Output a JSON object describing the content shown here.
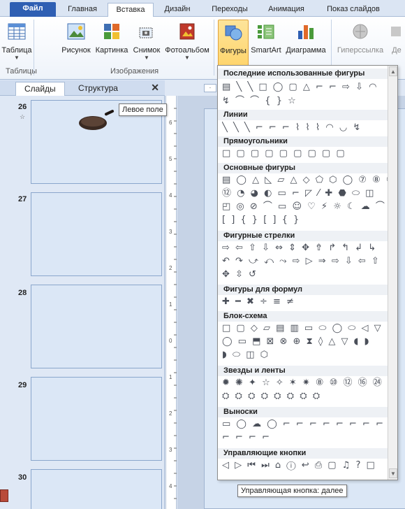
{
  "ribbon_tabs": [
    {
      "label": "Файл"
    },
    {
      "label": "Главная"
    },
    {
      "label": "Вставка"
    },
    {
      "label": "Дизайн"
    },
    {
      "label": "Переходы"
    },
    {
      "label": "Анимация"
    },
    {
      "label": "Показ слайдов"
    }
  ],
  "ribbon": {
    "buttons": [
      {
        "label": "Таблица",
        "icon": "table-icon"
      },
      {
        "label": "Рисунок",
        "icon": "picture-icon"
      },
      {
        "label": "Картинка",
        "icon": "clipart-icon"
      },
      {
        "label": "Снимок",
        "icon": "screenshot-icon"
      },
      {
        "label": "Фотоальбом",
        "icon": "photo-album-icon"
      },
      {
        "label": "Фигуры",
        "icon": "shapes-icon"
      },
      {
        "label": "SmartArt",
        "icon": "smartart-icon"
      },
      {
        "label": "Диаграмма",
        "icon": "chart-icon"
      },
      {
        "label": "Гиперссылка",
        "icon": "hyperlink-icon"
      },
      {
        "label": "Де",
        "icon": "action-icon"
      }
    ],
    "groups": {
      "tables": "Таблицы",
      "images": "Изображения"
    }
  },
  "left_pane": {
    "tabs": [
      "Слайды",
      "Структура"
    ],
    "close": "✕",
    "slides": [
      {
        "number": "26",
        "has_animation": true
      },
      {
        "number": "27"
      },
      {
        "number": "28"
      },
      {
        "number": "29"
      },
      {
        "number": "30"
      }
    ]
  },
  "tooltips": {
    "left_field": "Левое поле",
    "next_button": "Управляющая кнопка: далее"
  },
  "ruler": {
    "vertical_labels": [
      "6",
      "5",
      "4",
      "3",
      "2",
      "1",
      "0",
      "1",
      "2",
      "3",
      "4",
      "5"
    ],
    "h_stub": "·"
  },
  "gallery": {
    "categories": [
      {
        "title": "Последние использованные фигуры",
        "rows": [
          "▤ ╲ ╲ □ ◯ ▢ △ ⌐ ⌐ ⇨ ⇩ ◠",
          "↯ ⌒ ⌒ { } ☆"
        ]
      },
      {
        "title": "Линии",
        "rows": [
          "╲ ╲ ╲ ⌐ ⌐ ⌐ ⌇ ⌇ ⌇ ◠ ◡ ↯"
        ]
      },
      {
        "title": "Прямоугольники",
        "rows": [
          "□ ▢ ▢ ▢ ▢ ▢ ▢ ▢ ▢"
        ]
      },
      {
        "title": "Основные фигуры",
        "rows": [
          "▤ ◯ △ ◺ ▱ △ ◇ ⬠ ⬡ ◯ ⑦ ⑧ ⑩",
          "⑫ ◔ ◕ ◐ ▭ ⌐ ◸ ⁄ ✚ ⬣ ⬭ ◫",
          "◰ ◎ ⊘ ⌒ ▭ ☺ ♡ ⚡ ☼ ☾ ☁ ⌒",
          "[ ] { } [ ] { }"
        ]
      },
      {
        "title": "Фигурные стрелки",
        "rows": [
          "⇨ ⇦ ⇧ ⇩ ⇔ ⇕ ✥ ⇮ ↱ ↰ ↲ ↳",
          "↶ ↷ ⤻ ⤺ ⤳ ⇨ ▷ ⇒ ⇨ ⇩ ⇦ ⇧",
          "✥ ⇳ ↺"
        ]
      },
      {
        "title": "Фигуры для формул",
        "rows": [
          "✚ ━ ✖ ÷ ≡ ≠"
        ]
      },
      {
        "title": "Блок-схема",
        "rows": [
          "□ ▢ ◇ ▱ ▤ ▥ ▭ ⬭ ◯ ⬭ ◁ ▽",
          "◯ ▭ ⬒ ⊠ ⊗ ⊕ ⧗ ◊ △ ▽ ◖ ◗",
          "◗ ⬭ ◫ ⬡"
        ]
      },
      {
        "title": "Звезды и ленты",
        "rows": [
          "✹ ✺ ✦ ☆ ✧ ✶ ✷ ⑧ ⑩ ⑫ ⑯ ㉔ ㉜",
          "⛭ ⛭ ⛭ ⛭ ⛭ ⛭ ⛭ ⛭"
        ]
      },
      {
        "title": "Выноски",
        "rows": [
          "▭ ◯ ☁ ◯ ⌐ ⌐ ⌐ ⌐ ⌐ ⌐ ⌐ ⌐",
          "⌐ ⌐ ⌐ ⌐"
        ]
      },
      {
        "title": "Управляющие кнопки",
        "rows": [
          "◁ ▷ ⏮ ⏭ ⌂ ⓘ ↩ ⎙ ▢ ♫ ? □"
        ]
      }
    ]
  }
}
